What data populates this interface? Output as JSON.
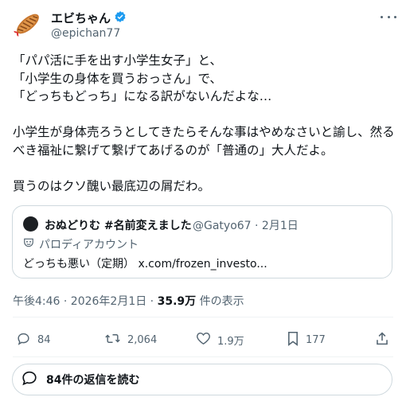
{
  "author": {
    "name": "エビちゃん",
    "handle": "@epichan77",
    "verified": true
  },
  "tweet": {
    "lines_1": [
      "「パパ活に手を出す小学生女子」と、",
      "「小学生の身体を買うおっさん」で、",
      "「どっちもどっち」になる訳がないんだよな…"
    ],
    "para_2": "小学生が身体売ろうとしてきたらそんな事はやめなさいと諭し、然るべき福祉に繋げて繋げてあげるのが「普通の」大人だよ。",
    "para_3": "買うのはクソ醜い最底辺の屑だわ。"
  },
  "quote": {
    "name": "おぬどりむ #名前変えました",
    "handle_date": "@Gatyo67 · 2月1日",
    "parody_label": "パロディアカウント",
    "text": "どっちも悪い（定期） x.com/frozen_investo..."
  },
  "meta": {
    "time": "午後4:46 · 2026年2月1日 · ",
    "views": "35.9万",
    "views_suffix": " 件の表示"
  },
  "actions": {
    "replies": "84",
    "reposts": "2,064",
    "likes": "1.9万",
    "bookmarks": "177"
  },
  "read_replies": {
    "label": "84件の返信を読む"
  },
  "colors": {
    "verified": "#1d9bf0",
    "secondary": "#536471",
    "border": "#cfd9de"
  }
}
